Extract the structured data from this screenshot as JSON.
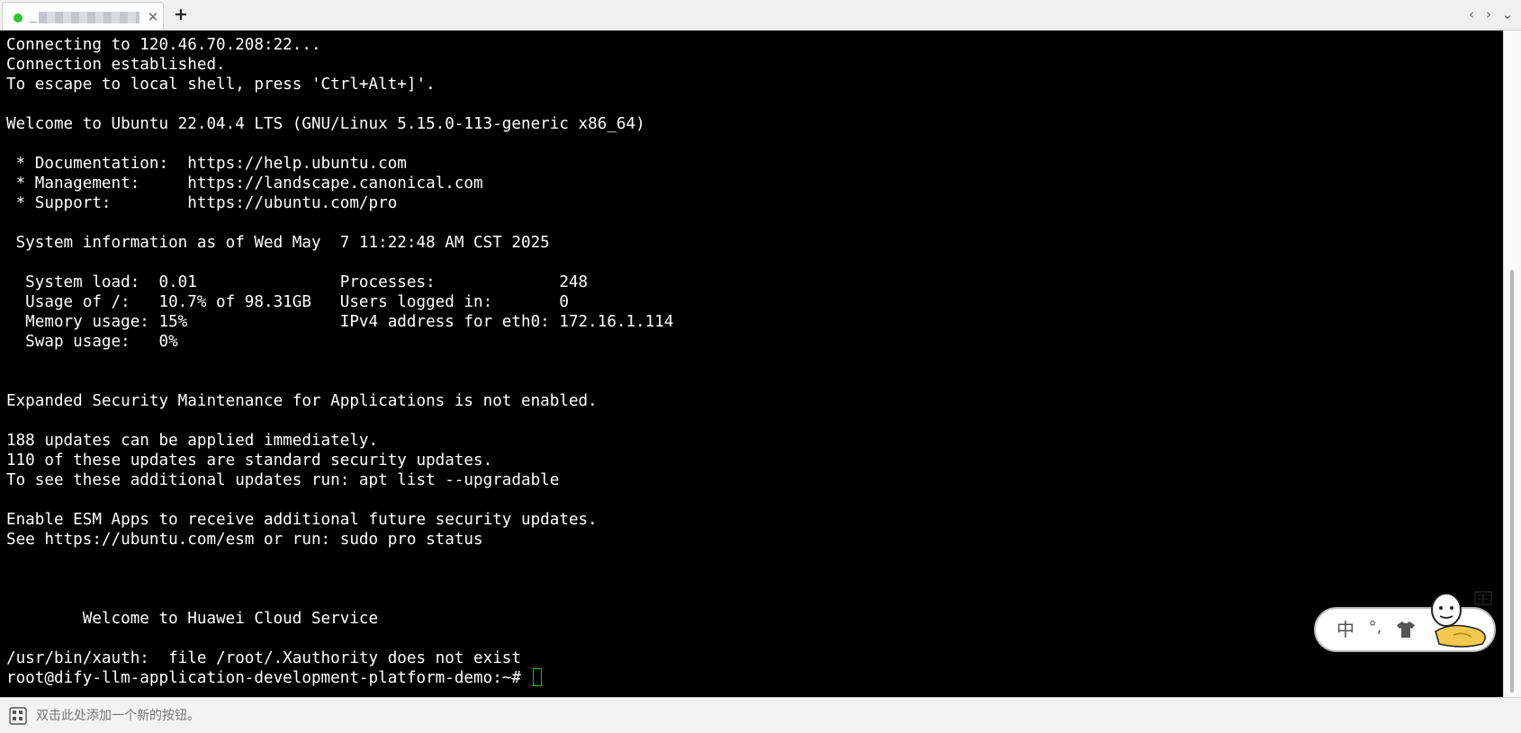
{
  "tab": {
    "title": "_",
    "status_color": "#2ec82e",
    "close_label": "✕"
  },
  "toolbar": {
    "new_tab_label": "+",
    "prev_label": "‹",
    "next_label": "›",
    "menu_label": "⌄"
  },
  "terminal": {
    "lines": [
      "Connecting to 120.46.70.208:22...",
      "Connection established.",
      "To escape to local shell, press 'Ctrl+Alt+]'.",
      "",
      "Welcome to Ubuntu 22.04.4 LTS (GNU/Linux 5.15.0-113-generic x86_64)",
      "",
      " * Documentation:  https://help.ubuntu.com",
      " * Management:     https://landscape.canonical.com",
      " * Support:        https://ubuntu.com/pro",
      "",
      " System information as of Wed May  7 11:22:48 AM CST 2025",
      "",
      "  System load:  0.01               Processes:             248",
      "  Usage of /:   10.7% of 98.31GB   Users logged in:       0",
      "  Memory usage: 15%                IPv4 address for eth0: 172.16.1.114",
      "  Swap usage:   0%",
      "",
      "",
      "Expanded Security Maintenance for Applications is not enabled.",
      "",
      "188 updates can be applied immediately.",
      "110 of these updates are standard security updates.",
      "To see these additional updates run: apt list --upgradable",
      "",
      "Enable ESM Apps to receive additional future security updates.",
      "See https://ubuntu.com/esm or run: sudo pro status",
      "",
      "",
      "",
      "        Welcome to Huawei Cloud Service",
      "",
      "/usr/bin/xauth:  file /root/.Xauthority does not exist"
    ],
    "prompt": "root@dify-llm-application-development-platform-demo:~# ",
    "cursor_color": "#00d000"
  },
  "ime": {
    "mode_label": "中",
    "punct_label": "°,",
    "skin_icon": "tshirt-icon",
    "mascot_icon": "mascot-icon"
  },
  "bottom_bar": {
    "hint": "双击此处添加一个新的按钮。",
    "icon": "button-grid-icon"
  }
}
